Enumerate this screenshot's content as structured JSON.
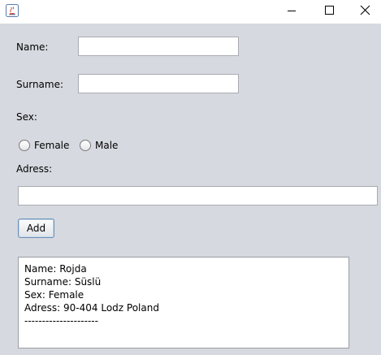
{
  "window": {
    "title": "",
    "controls": {
      "minimize": "minimize-icon",
      "maximize": "maximize-icon",
      "close": "close-icon"
    }
  },
  "form": {
    "name_label": "Name:",
    "name_value": "",
    "surname_label": "Surname:",
    "surname_value": "",
    "sex_label": "Sex:",
    "options": [
      {
        "label": "Female",
        "selected": false
      },
      {
        "label": "Male",
        "selected": false
      }
    ],
    "address_label": "Adress:",
    "address_value": "",
    "add_label": "Add"
  },
  "output": {
    "lines": [
      "Name: Rojda",
      "Surname: Süslü",
      "Sex: Female",
      "Adress: 90-404 Lodz Poland",
      "---------------------"
    ]
  }
}
